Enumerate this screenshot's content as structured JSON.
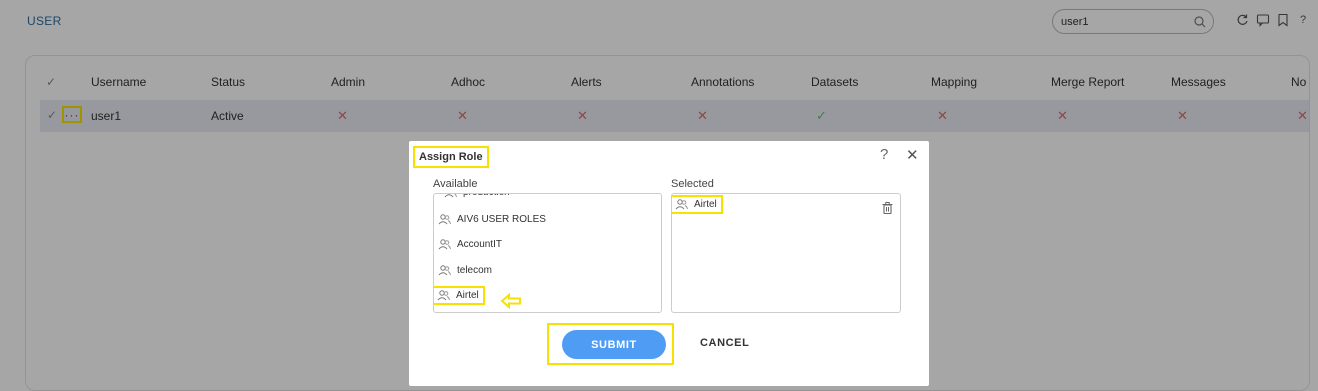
{
  "app": {
    "title": "USER"
  },
  "search": {
    "value": "user1"
  },
  "header_icons": [
    "refresh-icon",
    "chat-icon",
    "bookmark-icon",
    "help-icon"
  ],
  "table": {
    "columns": [
      "Username",
      "Status",
      "Admin",
      "Adhoc",
      "Alerts",
      "Annotations",
      "Datasets",
      "Mapping",
      "Merge Report",
      "Messages",
      "No"
    ],
    "rows": [
      {
        "username": "user1",
        "status": "Active",
        "more_label": "···",
        "permissions": [
          "✕",
          "✕",
          "✕",
          "✕",
          "✓",
          "✕",
          "✕",
          "✕",
          "✕"
        ]
      }
    ]
  },
  "dialog": {
    "title": "Assign Role",
    "available_label": "Available",
    "selected_label": "Selected",
    "available": [
      "production",
      "AIV6 USER ROLES",
      "AccountIT",
      "telecom",
      "Airtel"
    ],
    "selected": [
      "Airtel"
    ],
    "submit_label": "SUBMIT",
    "cancel_label": "CANCEL"
  },
  "colors": {
    "accent": "#4f9cf5",
    "highlight": "#f5e200",
    "error": "#e06b6b",
    "success": "#6cc06c"
  }
}
